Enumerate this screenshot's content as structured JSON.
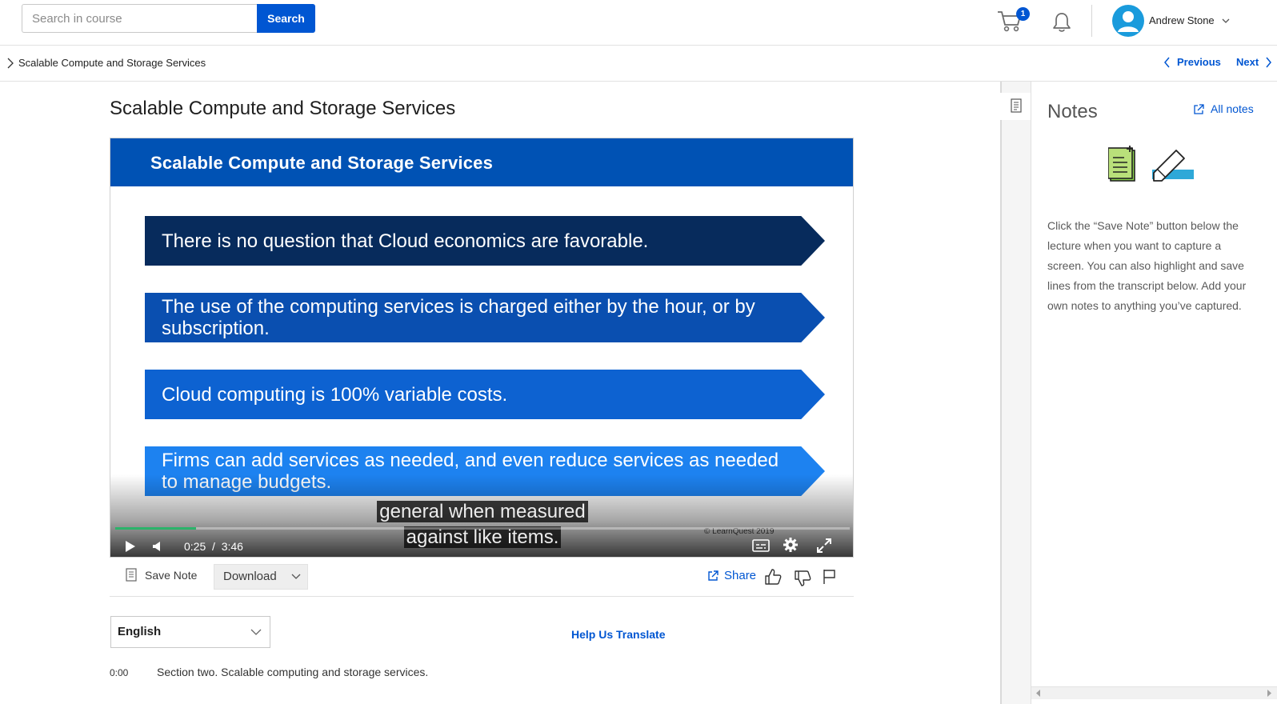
{
  "header": {
    "search_placeholder": "Search in course",
    "search_button": "Search",
    "cart_count": "1",
    "user_name": "Andrew Stone"
  },
  "breadcrumb": {
    "current": "Scalable Compute and Storage Services",
    "previous_label": "Previous",
    "next_label": "Next"
  },
  "lecture": {
    "title": "Scalable Compute and Storage Services"
  },
  "slide": {
    "title": "Scalable Compute and Storage Services",
    "bullets": [
      "There is no question that Cloud economics are favorable.",
      "The use of the computing services is charged either by the hour, or by subscription.",
      "Cloud computing is 100% variable costs.",
      "Firms can add services as needed, and even reduce services as needed to manage budgets."
    ],
    "watermark": "© LearnQuest 2019"
  },
  "player": {
    "caption_line1": "general when measured",
    "caption_line2": "against like items.",
    "current_time": "0:25",
    "duration": "3:46",
    "time_display": "0:25  /  3:46",
    "progress_fraction": 0.11,
    "accent_color": "#2bb36a"
  },
  "toolbar": {
    "save_note_label": "Save Note",
    "download_label": "Download",
    "share_label": "Share"
  },
  "transcript": {
    "language": "English",
    "help_translate": "Help Us Translate",
    "entries": [
      {
        "time": "0:00",
        "text": "Section two. Scalable computing and storage services."
      }
    ]
  },
  "notes": {
    "title": "Notes",
    "all_notes_label": "All notes",
    "description": "Click the “Save Note” button below the lecture when you want to capture a screen. You can also highlight and save lines from the transcript below. Add your own notes to anything you’ve captured."
  },
  "colors": {
    "brand": "#0056d2",
    "slide_header": "#0052b4",
    "avatar": "#1a9bdc"
  }
}
